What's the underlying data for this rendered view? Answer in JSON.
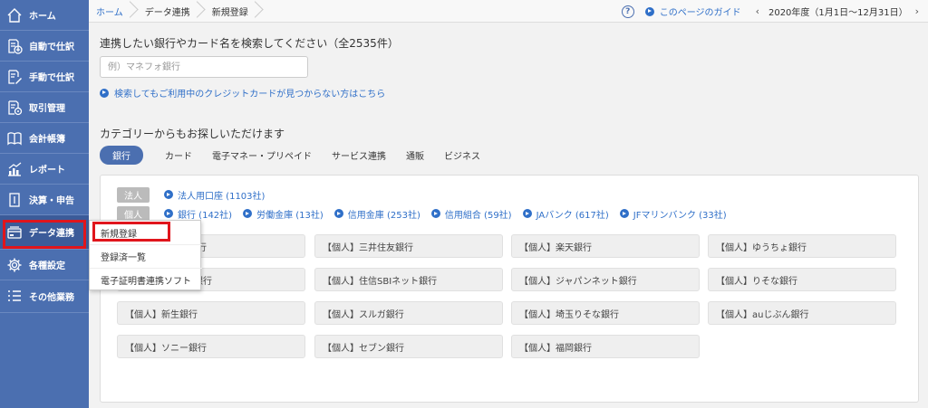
{
  "sidebar": {
    "items": [
      {
        "label": "ホーム",
        "icon": "home-icon"
      },
      {
        "label": "自動で仕訳",
        "icon": "auto-journal-icon"
      },
      {
        "label": "手動で仕訳",
        "icon": "manual-journal-icon"
      },
      {
        "label": "取引管理",
        "icon": "transaction-icon"
      },
      {
        "label": "会計帳簿",
        "icon": "ledger-icon"
      },
      {
        "label": "レポート",
        "icon": "report-icon"
      },
      {
        "label": "決算・申告",
        "icon": "settlement-icon"
      },
      {
        "label": "データ連携",
        "icon": "data-link-icon"
      },
      {
        "label": "各種設定",
        "icon": "gear-icon"
      },
      {
        "label": "その他業務",
        "icon": "list-icon"
      }
    ]
  },
  "breadcrumb": {
    "items": [
      "ホーム",
      "データ連携",
      "新規登録"
    ]
  },
  "header": {
    "help_icon": "?",
    "guide_label": "このページのガイド",
    "prev_icon": "‹",
    "next_icon": "›",
    "fiscal_year": "2020年度（1月1日〜12月31日）"
  },
  "search": {
    "title": "連携したい銀行やカード名を検索してください（全2535件）",
    "placeholder": "例）マネフォ銀行",
    "value": "",
    "help_link": "検索してもご利用中のクレジットカードが見つからない方はこちら"
  },
  "category": {
    "title": "カテゴリーからもお探しいただけます",
    "tabs": [
      "銀行",
      "カード",
      "電子マネー・プリペイド",
      "サービス連携",
      "通販",
      "ビジネス"
    ],
    "active_tab": "銀行"
  },
  "filters": {
    "corporate": {
      "tag": "法人",
      "links": [
        "法人用口座 (1103社)"
      ]
    },
    "personal": {
      "tag": "個人",
      "links": [
        "銀行 (142社)",
        "労働金庫 (13社)",
        "信用金庫 (253社)",
        "信用組合 (59社)",
        "JAバンク (617社)",
        "JFマリンバンク (33社)"
      ]
    }
  },
  "banks": [
    "【個人】みずほ銀行",
    "【個人】三井住友銀行",
    "【個人】楽天銀行",
    "【個人】ゆうちょ銀行",
    "【個人】三菱UFJ銀行",
    "【個人】住信SBIネット銀行",
    "【個人】ジャパンネット銀行",
    "【個人】りそな銀行",
    "【個人】新生銀行",
    "【個人】スルガ銀行",
    "【個人】埼玉りそな銀行",
    "【個人】auじぶん銀行",
    "【個人】ソニー銀行",
    "【個人】セブン銀行",
    "【個人】福岡銀行"
  ],
  "dropdown": {
    "items": [
      "新規登録",
      "登録済一覧",
      "電子証明書連携ソフト"
    ]
  },
  "colors": {
    "sidebar": "#4b6fb0",
    "link": "#2f6fc8",
    "highlight": "#e0151c"
  }
}
